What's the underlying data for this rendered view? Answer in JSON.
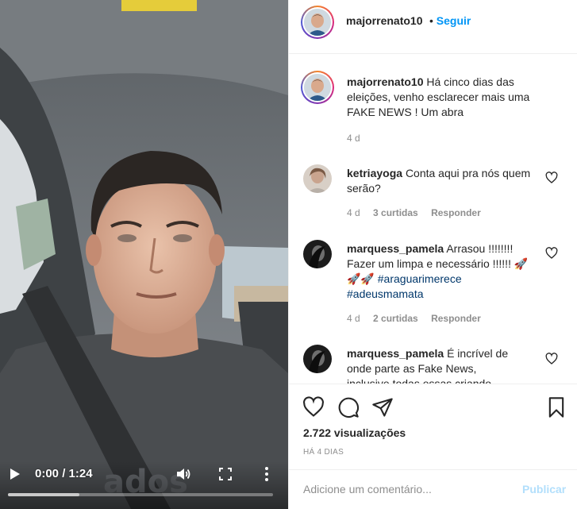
{
  "video": {
    "time_current": "0:00",
    "time_total": "1:24",
    "progress": 0.0,
    "play_icon": "play-icon",
    "volume_icon": "volume-icon",
    "fullscreen_icon": "fullscreen-icon",
    "more_icon": "more-vertical-icon"
  },
  "header": {
    "username": "majorrenato10",
    "separator": "•",
    "follow_label": "Seguir"
  },
  "caption": {
    "username": "majorrenato10",
    "text": "Há cinco dias das eleições, venho esclarecer mais uma FAKE NEWS ! Um abra",
    "age": "4 d"
  },
  "comments": [
    {
      "username": "ketriayoga",
      "text": "Conta aqui pra nós quem serão?",
      "age": "4 d",
      "likes": "3 curtidas",
      "reply_label": "Responder"
    },
    {
      "username": "marquess_pamela",
      "text_line1": "Arrasou !!!!!!!! Fazer um limpa e necessário !!!!!!",
      "emoji": "🚀🚀🚀",
      "hashtag1": "#araguarimerece",
      "hashtag2": "#adeusmamata",
      "age": "4 d",
      "likes": "2 curtidas",
      "reply_label": "Responder"
    },
    {
      "username": "marquess_pamela",
      "text": "É incrível de onde parte as Fake News, inclusive todas essas criando"
    }
  ],
  "actions": {
    "like_icon": "heart-icon",
    "comment_icon": "comment-icon",
    "share_icon": "share-icon",
    "save_icon": "bookmark-icon",
    "views": "2.722 visualizações",
    "posted_ago": "HÁ 4 DIAS"
  },
  "add_comment": {
    "placeholder": "Adicione um comentário...",
    "publish_label": "Publicar"
  },
  "colors": {
    "follow_blue": "#0095f6",
    "publish_disabled": "#b2dffc",
    "hashtag": "#00376b",
    "muted": "#8e8e8e"
  }
}
